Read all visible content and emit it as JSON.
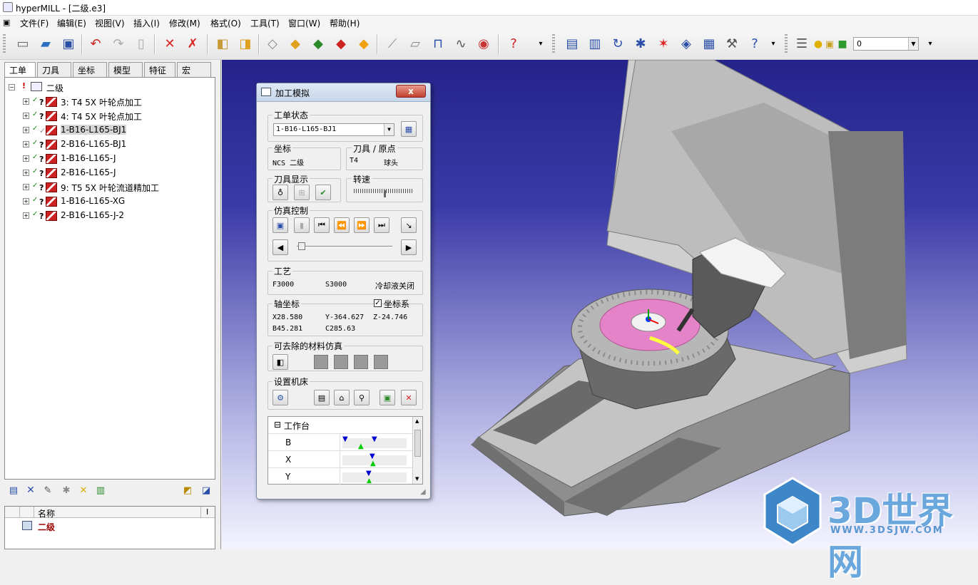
{
  "window": {
    "title": "hyperMILL - [二级.e3]"
  },
  "menu": [
    "文件(F)",
    "编辑(E)",
    "视图(V)",
    "插入(I)",
    "修改(M)",
    "格式(O)",
    "工具(T)",
    "窗口(W)",
    "帮助(H)"
  ],
  "toolbar": {
    "layer_value": "0"
  },
  "left_tabs": [
    "工单",
    "刀具",
    "坐标",
    "模型",
    "特征",
    "宏"
  ],
  "tree": {
    "root": "二级",
    "items": [
      {
        "label": "3: T4 5X 叶轮点加工",
        "selected": false
      },
      {
        "label": "4: T4 5X 叶轮点加工",
        "selected": false
      },
      {
        "label": "1-B16-L165-BJ1",
        "selected": true
      },
      {
        "label": "2-B16-L165-BJ1",
        "selected": false
      },
      {
        "label": "1-B16-L165-J",
        "selected": false
      },
      {
        "label": "2-B16-L165-J",
        "selected": false
      },
      {
        "label": "9: T5 5X 叶轮流道精加工",
        "selected": false
      },
      {
        "label": "1-B16-L165-XG",
        "selected": false
      },
      {
        "label": "2-B16-L165-J-2",
        "selected": false
      }
    ]
  },
  "props": {
    "col_name": "名称",
    "col_i": "I",
    "row_value": "二级"
  },
  "dialog": {
    "title": "加工模拟",
    "close": "x",
    "job_status_label": "工单状态",
    "job_value": "1-B16-L165-BJ1",
    "coord_label": "坐标",
    "coord_value": "NCS 二级",
    "tool_label": "刀具 / 原点",
    "tool_value": "T4",
    "tool_origin": "球头",
    "tool_display_label": "刀具显示",
    "speed_label": "转速",
    "sim_control_label": "仿真控制",
    "process_label": "工艺",
    "feed": "F3000",
    "spindle": "S3000",
    "coolant": "冷却液关闭",
    "axis_label": "轴坐标",
    "coord_sys_label": "坐标系",
    "coord_sys_checked": true,
    "x": "X28.580",
    "y": "Y-364.627",
    "z": "Z-24.746",
    "b": "B45.281",
    "c": "C285.63",
    "material_label": "可去除的材料仿真",
    "machine_label": "设置机床",
    "table_header": "工作台",
    "axes": [
      "B",
      "X",
      "Y"
    ]
  },
  "watermark": {
    "brand": "3D世界网",
    "url": "WWW.3DSJW.COM"
  }
}
